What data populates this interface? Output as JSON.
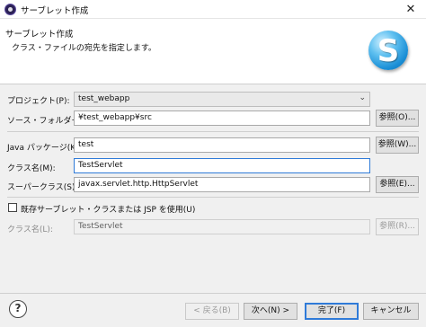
{
  "window": {
    "title": "サーブレット作成",
    "close": "✕"
  },
  "banner": {
    "title": "サーブレット作成",
    "description": "クラス・ファイルの宛先を指定します。",
    "logo_letter": "S"
  },
  "form": {
    "project": {
      "label": "プロジェクト(P):",
      "value": "test_webapp"
    },
    "source_folder": {
      "label": "ソース・フォルダー(D):",
      "value": "¥test_webapp¥src",
      "browse": "参照(O)..."
    },
    "java_package": {
      "label": "Java パッケージ(K):",
      "value": "test",
      "browse": "参照(W)..."
    },
    "class_name": {
      "label": "クラス名(M):",
      "value": "TestServlet"
    },
    "superclass": {
      "label": "スーパークラス(S):",
      "value": "javax.servlet.http.HttpServlet",
      "browse": "参照(E)..."
    },
    "use_existing": {
      "label": "既存サーブレット・クラスまたは JSP を使用(U)",
      "checked": false
    },
    "existing_class": {
      "label": "クラス名(L):",
      "value": "TestServlet",
      "browse": "参照(R)..."
    }
  },
  "footer": {
    "help": "?",
    "back": "< 戻る(B)",
    "next": "次へ(N) >",
    "finish": "完了(F)",
    "cancel": "キャンセル"
  }
}
